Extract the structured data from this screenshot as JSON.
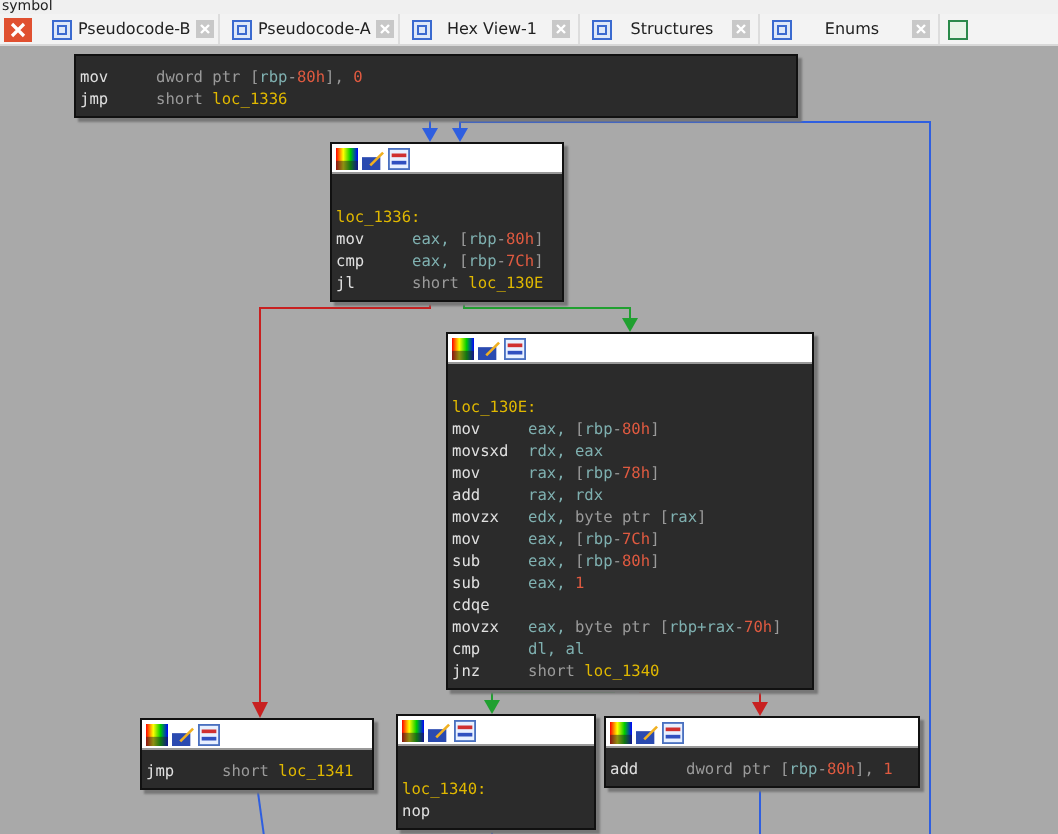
{
  "top_label": "symbol",
  "tabs": [
    {
      "label": "Pseudocode-B",
      "selected": false
    },
    {
      "label": "Pseudocode-A",
      "selected": false
    },
    {
      "label": "Hex View-1",
      "selected": false
    },
    {
      "label": "Structures",
      "selected": false
    },
    {
      "label": "Enums",
      "selected": false
    }
  ],
  "nodes": [
    {
      "header": false,
      "lines": [
        {
          "mnem": "mov",
          "ops": [
            {
              "text": "dword ptr [",
              "kind": "plain"
            },
            {
              "text": "rbp",
              "kind": "reg"
            },
            {
              "text": "-",
              "kind": "plain"
            },
            {
              "text": "80h",
              "kind": "num"
            },
            {
              "text": "], ",
              "kind": "plain"
            },
            {
              "text": "0",
              "kind": "num"
            }
          ]
        },
        {
          "mnem": "jmp",
          "ops": [
            {
              "text": "short ",
              "kind": "plain"
            },
            {
              "text": "loc_1336",
              "kind": "label"
            }
          ]
        }
      ]
    },
    {
      "header": true,
      "lines": [
        {
          "label": "loc_1336:"
        },
        {
          "mnem": "mov",
          "ops": [
            {
              "text": "eax, ",
              "kind": "reg"
            },
            {
              "text": "[",
              "kind": "plain"
            },
            {
              "text": "rbp",
              "kind": "reg"
            },
            {
              "text": "-",
              "kind": "plain"
            },
            {
              "text": "80h",
              "kind": "num"
            },
            {
              "text": "]",
              "kind": "plain"
            }
          ]
        },
        {
          "mnem": "cmp",
          "ops": [
            {
              "text": "eax, ",
              "kind": "reg"
            },
            {
              "text": "[",
              "kind": "plain"
            },
            {
              "text": "rbp",
              "kind": "reg"
            },
            {
              "text": "-",
              "kind": "plain"
            },
            {
              "text": "7Ch",
              "kind": "num"
            },
            {
              "text": "]",
              "kind": "plain"
            }
          ]
        },
        {
          "mnem": "jl",
          "ops": [
            {
              "text": "short ",
              "kind": "plain"
            },
            {
              "text": "loc_130E",
              "kind": "label"
            }
          ]
        }
      ]
    },
    {
      "header": true,
      "lines": [
        {
          "label": "loc_130E:"
        },
        {
          "mnem": "mov",
          "ops": [
            {
              "text": "eax, ",
              "kind": "reg"
            },
            {
              "text": "[",
              "kind": "plain"
            },
            {
              "text": "rbp",
              "kind": "reg"
            },
            {
              "text": "-",
              "kind": "plain"
            },
            {
              "text": "80h",
              "kind": "num"
            },
            {
              "text": "]",
              "kind": "plain"
            }
          ]
        },
        {
          "mnem": "movsxd",
          "ops": [
            {
              "text": "rdx, eax",
              "kind": "reg"
            }
          ]
        },
        {
          "mnem": "mov",
          "ops": [
            {
              "text": "rax, ",
              "kind": "reg"
            },
            {
              "text": "[",
              "kind": "plain"
            },
            {
              "text": "rbp",
              "kind": "reg"
            },
            {
              "text": "-",
              "kind": "plain"
            },
            {
              "text": "78h",
              "kind": "num"
            },
            {
              "text": "]",
              "kind": "plain"
            }
          ]
        },
        {
          "mnem": "add",
          "ops": [
            {
              "text": "rax, rdx",
              "kind": "reg"
            }
          ]
        },
        {
          "mnem": "movzx",
          "ops": [
            {
              "text": "edx, ",
              "kind": "reg"
            },
            {
              "text": "byte ptr [",
              "kind": "plain"
            },
            {
              "text": "rax",
              "kind": "reg"
            },
            {
              "text": "]",
              "kind": "plain"
            }
          ]
        },
        {
          "mnem": "mov",
          "ops": [
            {
              "text": "eax, ",
              "kind": "reg"
            },
            {
              "text": "[",
              "kind": "plain"
            },
            {
              "text": "rbp",
              "kind": "reg"
            },
            {
              "text": "-",
              "kind": "plain"
            },
            {
              "text": "7Ch",
              "kind": "num"
            },
            {
              "text": "]",
              "kind": "plain"
            }
          ]
        },
        {
          "mnem": "sub",
          "ops": [
            {
              "text": "eax, ",
              "kind": "reg"
            },
            {
              "text": "[",
              "kind": "plain"
            },
            {
              "text": "rbp",
              "kind": "reg"
            },
            {
              "text": "-",
              "kind": "plain"
            },
            {
              "text": "80h",
              "kind": "num"
            },
            {
              "text": "]",
              "kind": "plain"
            }
          ]
        },
        {
          "mnem": "sub",
          "ops": [
            {
              "text": "eax, ",
              "kind": "reg"
            },
            {
              "text": "1",
              "kind": "num"
            }
          ]
        },
        {
          "mnem": "cdqe"
        },
        {
          "mnem": "movzx",
          "ops": [
            {
              "text": "eax, ",
              "kind": "reg"
            },
            {
              "text": "byte ptr [",
              "kind": "plain"
            },
            {
              "text": "rbp+rax",
              "kind": "reg"
            },
            {
              "text": "-",
              "kind": "plain"
            },
            {
              "text": "70h",
              "kind": "num"
            },
            {
              "text": "]",
              "kind": "plain"
            }
          ]
        },
        {
          "mnem": "cmp",
          "ops": [
            {
              "text": "dl, al",
              "kind": "reg"
            }
          ]
        },
        {
          "mnem": "jnz",
          "ops": [
            {
              "text": "short ",
              "kind": "plain"
            },
            {
              "text": "loc_1340",
              "kind": "label"
            }
          ]
        }
      ]
    },
    {
      "header": true,
      "lines": [
        {
          "mnem": "jmp",
          "ops": [
            {
              "text": "short ",
              "kind": "plain"
            },
            {
              "text": "loc_1341",
              "kind": "label"
            }
          ]
        }
      ]
    },
    {
      "header": true,
      "lines": [
        {
          "label": "loc_1340:"
        },
        {
          "mnem": "nop"
        }
      ]
    },
    {
      "header": true,
      "lines": [
        {
          "mnem": "add",
          "ops": [
            {
              "text": "dword ptr [",
              "kind": "plain"
            },
            {
              "text": "rbp",
              "kind": "reg"
            },
            {
              "text": "-",
              "kind": "plain"
            },
            {
              "text": "80h",
              "kind": "num"
            },
            {
              "text": "], ",
              "kind": "plain"
            },
            {
              "text": "1",
              "kind": "num"
            }
          ]
        }
      ]
    }
  ]
}
